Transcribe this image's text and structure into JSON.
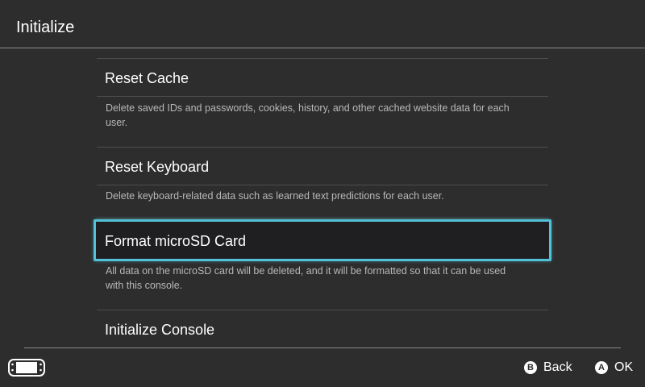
{
  "header": {
    "title": "Initialize"
  },
  "items": [
    {
      "title": "Reset Cache",
      "description_lines": [
        "Delete saved IDs and passwords, cookies, history, and other cached website data for each",
        "user."
      ]
    },
    {
      "title": "Reset Keyboard",
      "description_lines": [
        "Delete keyboard-related data such as learned text predictions for each user."
      ]
    },
    {
      "title": "Format microSD Card",
      "selected": true,
      "description_lines": [
        "All data on the microSD card will be deleted, and it will be formatted so that it can be used",
        "with this console."
      ]
    },
    {
      "title": "Initialize Console"
    }
  ],
  "footer": {
    "console_icon": "handheld-console-icon",
    "back": {
      "button": "B",
      "label": "Back"
    },
    "ok": {
      "button": "A",
      "label": "OK"
    }
  },
  "colors": {
    "background": "#2d2d2d",
    "selection": "#53c2d8",
    "description_text": "#b8b8b8"
  }
}
